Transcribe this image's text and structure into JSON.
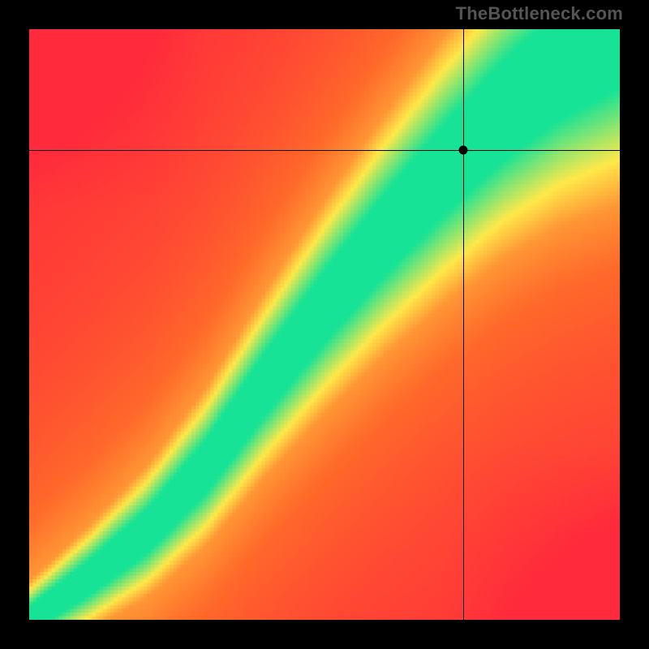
{
  "watermark": "TheBottleneck.com",
  "chart_data": {
    "type": "heatmap",
    "title": "",
    "xlabel": "",
    "ylabel": "",
    "xlim": [
      0,
      100
    ],
    "ylim": [
      0,
      100
    ],
    "colorscale_note": "value 0 = red, 0.5 = yellow, 1 = green; diagonal green band with slight S-curve",
    "grid_size": 160,
    "band_curve": {
      "description": "green ridge center as y fraction (from bottom) for given x fraction",
      "control_points": [
        {
          "x": 0.0,
          "y": 0.0
        },
        {
          "x": 0.1,
          "y": 0.07
        },
        {
          "x": 0.2,
          "y": 0.15
        },
        {
          "x": 0.3,
          "y": 0.26
        },
        {
          "x": 0.4,
          "y": 0.4
        },
        {
          "x": 0.5,
          "y": 0.53
        },
        {
          "x": 0.6,
          "y": 0.65
        },
        {
          "x": 0.7,
          "y": 0.76
        },
        {
          "x": 0.8,
          "y": 0.86
        },
        {
          "x": 0.9,
          "y": 0.94
        },
        {
          "x": 1.0,
          "y": 1.0
        }
      ],
      "half_width_frac": 0.055,
      "yellow_shoulder_frac": 0.11
    },
    "crosshair": {
      "x_frac": 0.735,
      "y_frac_from_top": 0.205
    },
    "marker": {
      "x_frac": 0.735,
      "y_frac_from_top": 0.205
    }
  },
  "colors": {
    "red": "#ff2a3c",
    "orange": "#ff6a2a",
    "yellow": "#ffe94a",
    "green": "#17e396",
    "black": "#000000",
    "wm": "#555555"
  }
}
